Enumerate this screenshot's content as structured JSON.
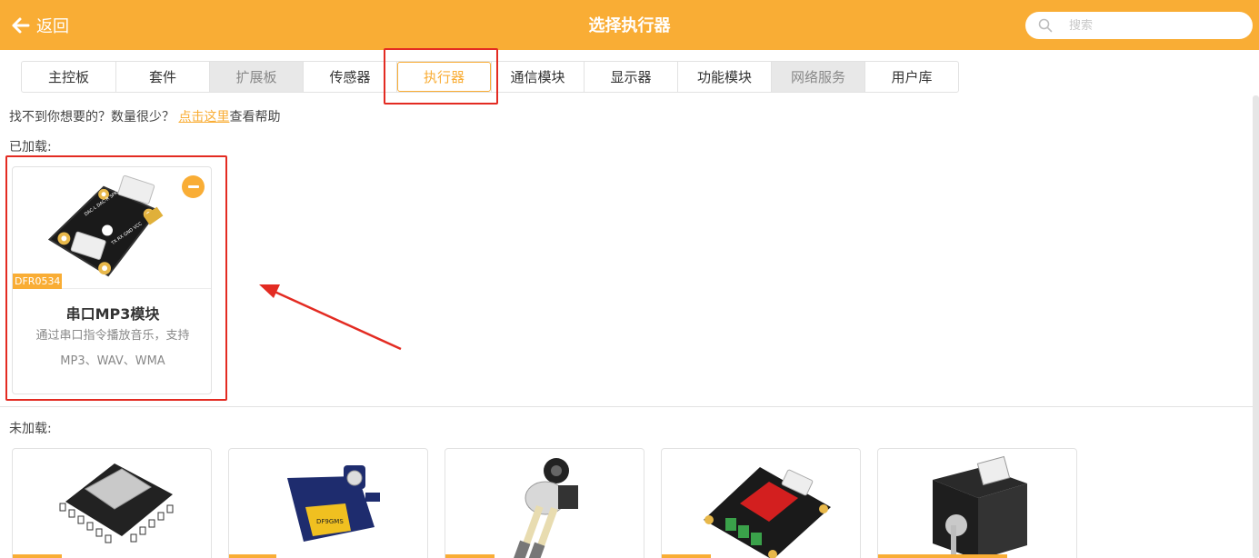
{
  "header": {
    "back_label": "返回",
    "title": "选择执行器",
    "search_placeholder": "搜索"
  },
  "tabs": [
    {
      "label": "主控板",
      "state": "normal"
    },
    {
      "label": "套件",
      "state": "normal"
    },
    {
      "label": "扩展板",
      "state": "disabled"
    },
    {
      "label": "传感器",
      "state": "normal"
    },
    {
      "label": "执行器",
      "state": "active"
    },
    {
      "label": "通信模块",
      "state": "normal"
    },
    {
      "label": "显示器",
      "state": "normal"
    },
    {
      "label": "功能模块",
      "state": "normal"
    },
    {
      "label": "网络服务",
      "state": "disabled"
    },
    {
      "label": "用户库",
      "state": "normal"
    }
  ],
  "help": {
    "prefix": "找不到你想要的？数量很少？",
    "link": "点击这里",
    "suffix": "查看帮助"
  },
  "loaded": {
    "label": "已加载:",
    "cards": [
      {
        "code": "DFR0534",
        "name": "串口MP3模块",
        "desc": "通过串口指令播放音乐，支持MP3、WAV、WMA"
      }
    ]
  },
  "unloaded": {
    "label": "未加载:",
    "cards": [
      {
        "icon": "mp3-player-module-icon"
      },
      {
        "icon": "servo-motor-icon"
      },
      {
        "icon": "peristaltic-pump-icon"
      },
      {
        "icon": "relay-module-icon"
      },
      {
        "icon": "stepper-motor-icon"
      }
    ]
  },
  "colors": {
    "accent": "#f9ad35",
    "highlight": "#e32b22"
  }
}
